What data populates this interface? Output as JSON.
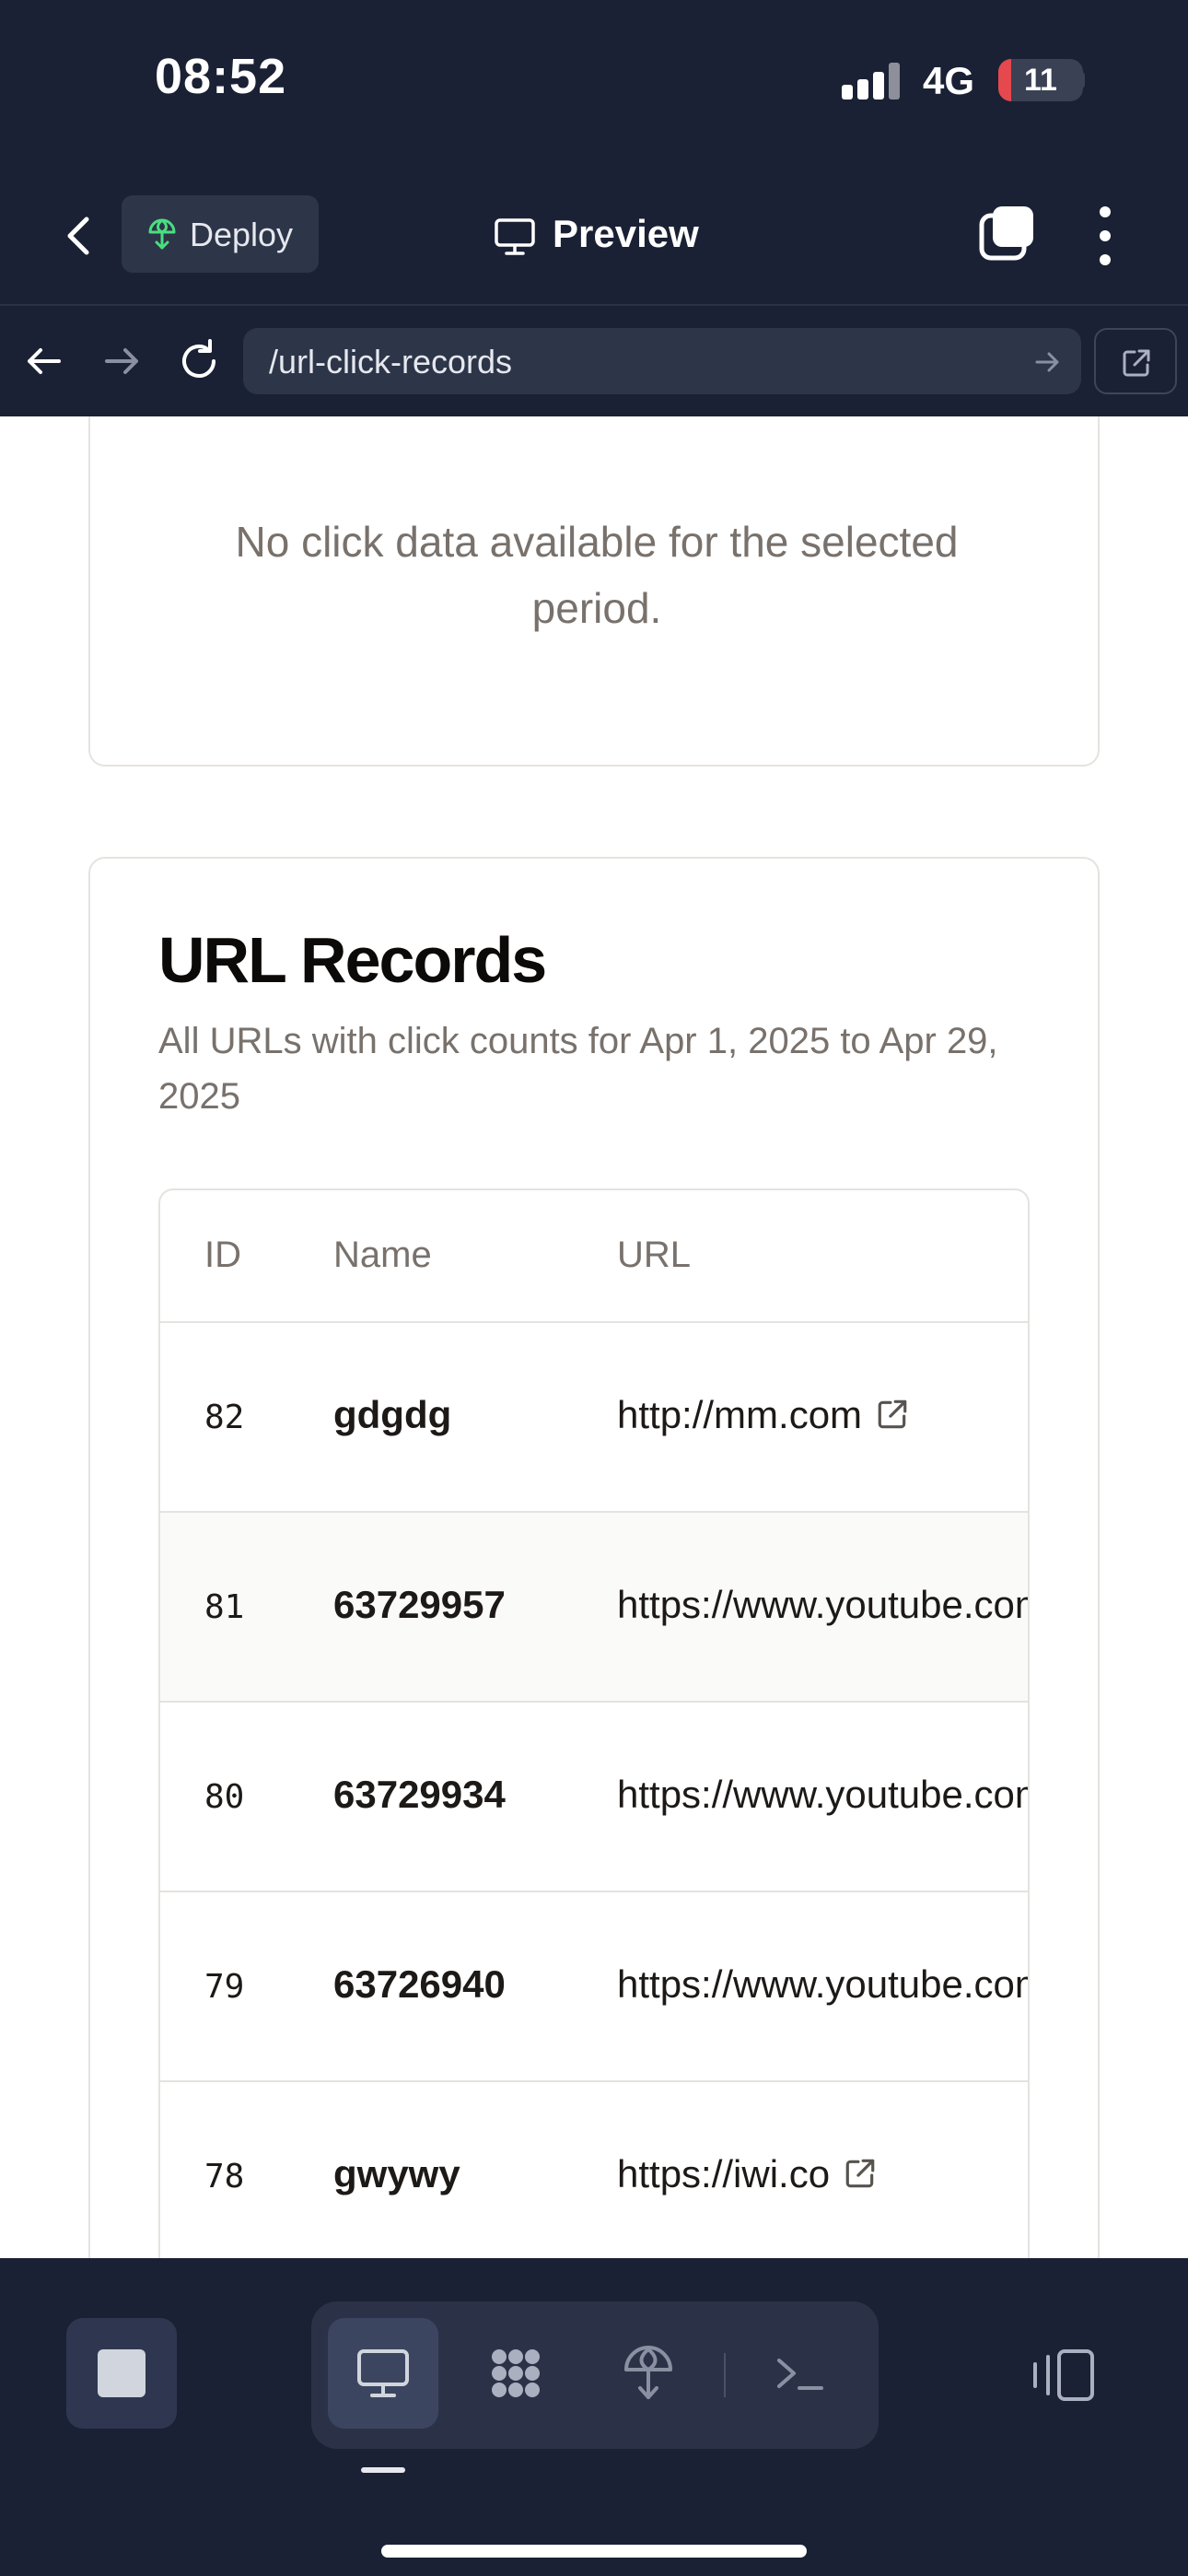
{
  "status_bar": {
    "time": "08:52",
    "network": "4G",
    "battery": "11"
  },
  "header": {
    "back_icon": "chevron-left-icon",
    "deploy_label": "Deploy",
    "title": "Preview"
  },
  "browser": {
    "url": "/url-click-records"
  },
  "empty_state": {
    "message": "No click data available for the selected period."
  },
  "records": {
    "title": "URL Records",
    "description": "All URLs with click counts for Apr 1, 2025 to Apr 29, 2025",
    "columns": [
      "ID",
      "Name",
      "URL"
    ],
    "rows": [
      {
        "id": "82",
        "name": "gdgdg",
        "url": "http://mm.com"
      },
      {
        "id": "81",
        "name": "63729957",
        "url": "https://www.youtube.com"
      },
      {
        "id": "80",
        "name": "63729934",
        "url": "https://www.youtube.com"
      },
      {
        "id": "79",
        "name": "63726940",
        "url": "https://www.youtube.com"
      },
      {
        "id": "78",
        "name": "gwywy",
        "url": "https://iwi.co"
      }
    ]
  },
  "colors": {
    "chrome_bg": "#1b2134",
    "accent_green": "#4ade80",
    "muted_text": "#78716c"
  }
}
